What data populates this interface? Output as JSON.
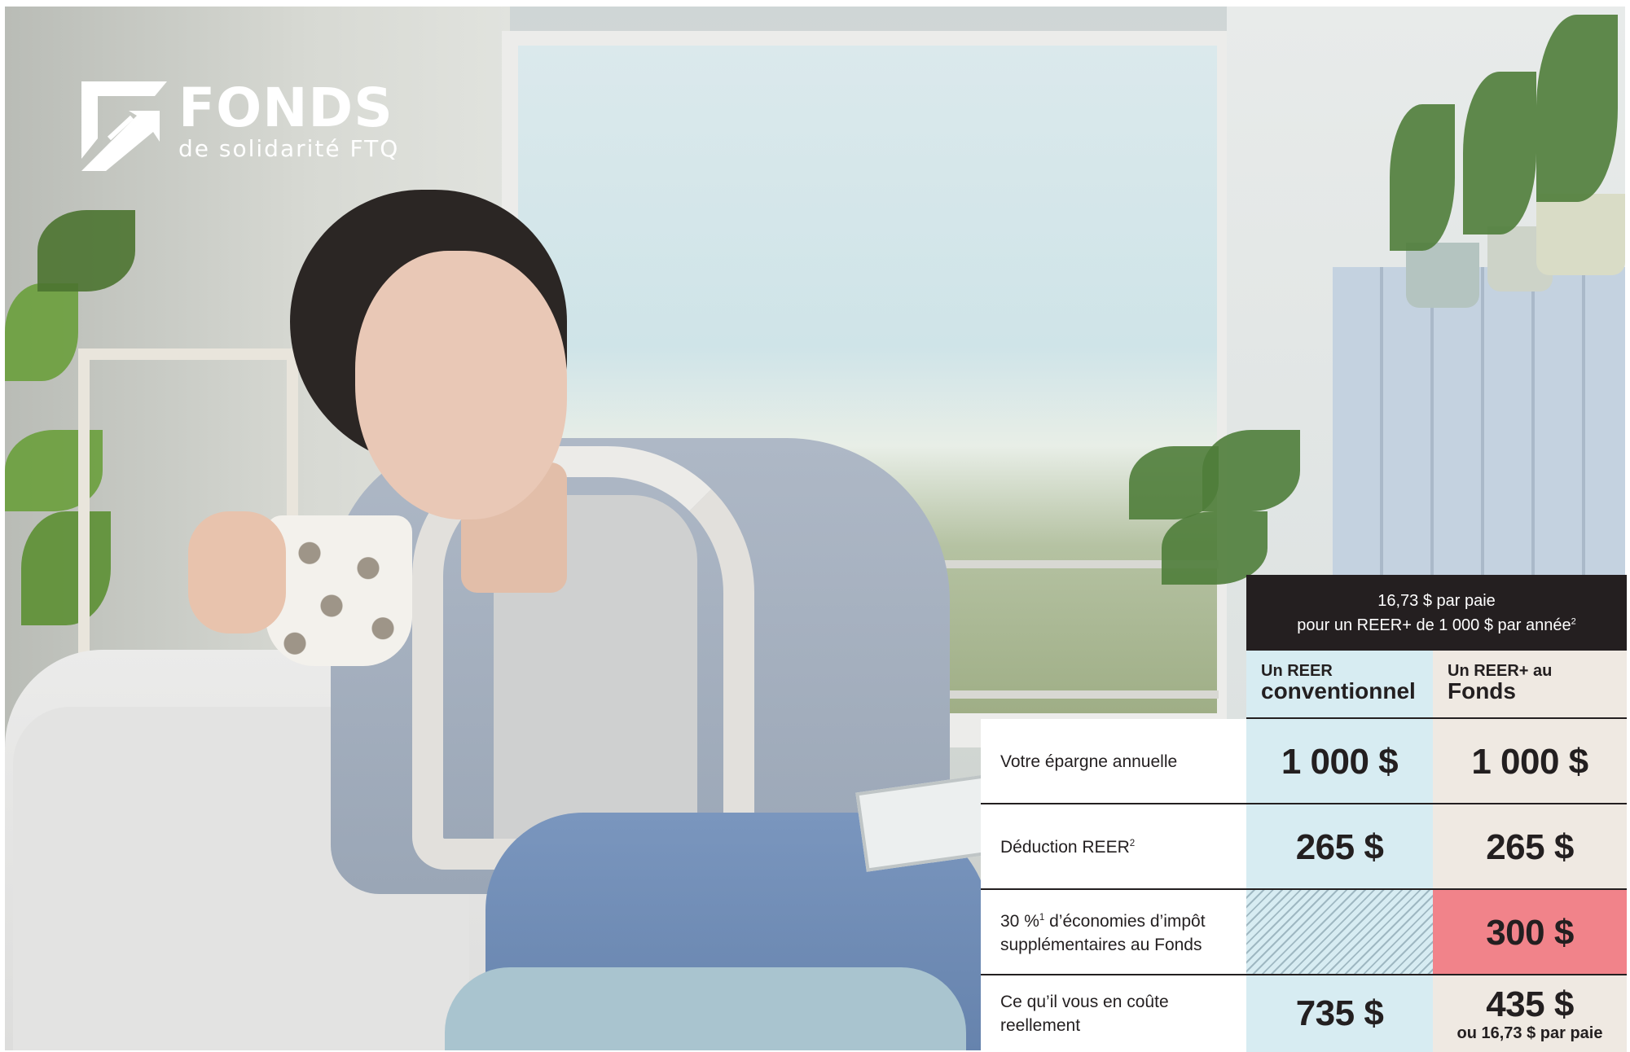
{
  "logo": {
    "title": "FONDS",
    "subtitle": "de solidarité FTQ",
    "icon": "ftq-arrow-logo-icon"
  },
  "table": {
    "header_line1": "16,73 $ par paie",
    "header_line2": "pour un REER+ de 1 000 $ par année",
    "header_sup": "2",
    "columns": [
      {
        "small": "Un REER",
        "big": "conventionnel"
      },
      {
        "small": "Un REER+ au",
        "big": "Fonds"
      }
    ],
    "rows": [
      {
        "label": "Votre épargne annuelle",
        "label_sup": "",
        "label2": "",
        "col1": "1 000 $",
        "col2": "1 000 $",
        "col2_sub": ""
      },
      {
        "label": "Déduction REER",
        "label_sup": "2",
        "label2": "",
        "col1": "265 $",
        "col2": "265 $",
        "col2_sub": ""
      },
      {
        "label": "30 %",
        "label_sup": "1",
        "label2": " d’économies d’impôt supplémentaires au Fonds",
        "col1": "",
        "col2": "300 $",
        "col2_sub": ""
      },
      {
        "label": "Ce qu’il vous en coûte reellement",
        "label_sup": "",
        "label2": "",
        "col1": "735 $",
        "col2": "435 $",
        "col2_sub": "ou 16,73 $ par paie"
      }
    ]
  },
  "colors": {
    "dark_header": "#241f20",
    "reer_column": "#d7ecf2",
    "fonds_column": "#efe9e2",
    "highlight": "#f1838a"
  }
}
